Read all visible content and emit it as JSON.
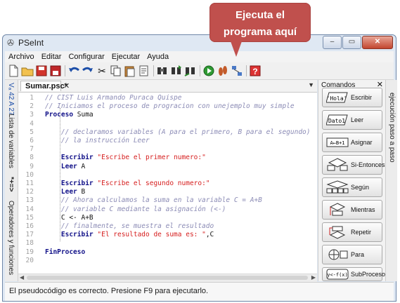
{
  "callout": {
    "line1": "Ejecuta el",
    "line2": "programa aquí"
  },
  "window": {
    "title": "PSeInt"
  },
  "menu": [
    "Archivo",
    "Editar",
    "Configurar",
    "Ejecutar",
    "Ayuda"
  ],
  "toolbar": {
    "icons": [
      "new-file-icon",
      "open-folder-icon",
      "save-icon",
      "save-as-icon",
      "undo-icon",
      "redo-icon",
      "cut-icon",
      "copy-icon",
      "paste-icon",
      "edit-icon",
      "search-icon",
      "search-next-icon",
      "replace-icon",
      "run-icon",
      "step-icon",
      "flowchart-icon",
      "help-icon"
    ]
  },
  "left_tabs": {
    "variables": "Lista de variables",
    "operators": "Operadores y funciones",
    "var_symbols": "Vₐ 42 A 27",
    "op_symbols": "*+=>"
  },
  "editor": {
    "file_tab": "Sumar.psc*",
    "lines": [
      {
        "n": "1",
        "text": "// CIST Luis Armando Puraca Quispe"
      },
      {
        "n": "2",
        "text": "// Iniciamos el proceso de progracion con unejemplo muy simple"
      },
      {
        "n": "3",
        "kw": "Proceso",
        "rest": " Suma"
      },
      {
        "n": "4",
        "text": ""
      },
      {
        "n": "5",
        "text": "    // declaramos variables (A para el primero, B para el segundo)"
      },
      {
        "n": "6",
        "text": "    // la instrucción Leer"
      },
      {
        "n": "7",
        "text": ""
      },
      {
        "n": "8",
        "kw": "Escribir",
        "str": "\"Escribe el primer numero:\""
      },
      {
        "n": "9",
        "kw": "Leer",
        "rest": " A"
      },
      {
        "n": "10",
        "text": ""
      },
      {
        "n": "11",
        "kw": "Escribir",
        "str": "\"Escribe el segundo numero:\""
      },
      {
        "n": "12",
        "kw": "Leer",
        "rest": " B"
      },
      {
        "n": "13",
        "text": "    // Ahora calculamos la suma en la variable C = A+B"
      },
      {
        "n": "14",
        "text": "    // variable C mediante la asignación (<-)"
      },
      {
        "n": "15",
        "plain": "    C <- A+B"
      },
      {
        "n": "16",
        "text": "    // finalmente, se muestra el resultado"
      },
      {
        "n": "17",
        "kw": "Escribir",
        "str": "\"El resultado de suma es: \"",
        "rest": ",C"
      },
      {
        "n": "18",
        "text": ""
      },
      {
        "n": "19",
        "kw": "FinProceso",
        "indent": ""
      },
      {
        "n": "20",
        "text": ""
      }
    ]
  },
  "commands": {
    "header": "Comandos",
    "items": [
      {
        "label": "Escribir",
        "icon_text": "'Hola'"
      },
      {
        "label": "Leer",
        "icon_text": "Dato1"
      },
      {
        "label": "Asignar",
        "icon_text": "A←B+1"
      },
      {
        "label": "Si-Entonces",
        "icon_text": ""
      },
      {
        "label": "Según",
        "icon_text": ""
      },
      {
        "label": "Mientras",
        "icon_text": ""
      },
      {
        "label": "Repetir",
        "icon_text": ""
      },
      {
        "label": "Para",
        "icon_text": ""
      },
      {
        "label": "SubProceso",
        "icon_text": "y<-f(x)"
      }
    ]
  },
  "right_tab": "ejecución paso a paso",
  "status": "El pseudocódigo es correcto. Presione F9 para ejecutarlo."
}
